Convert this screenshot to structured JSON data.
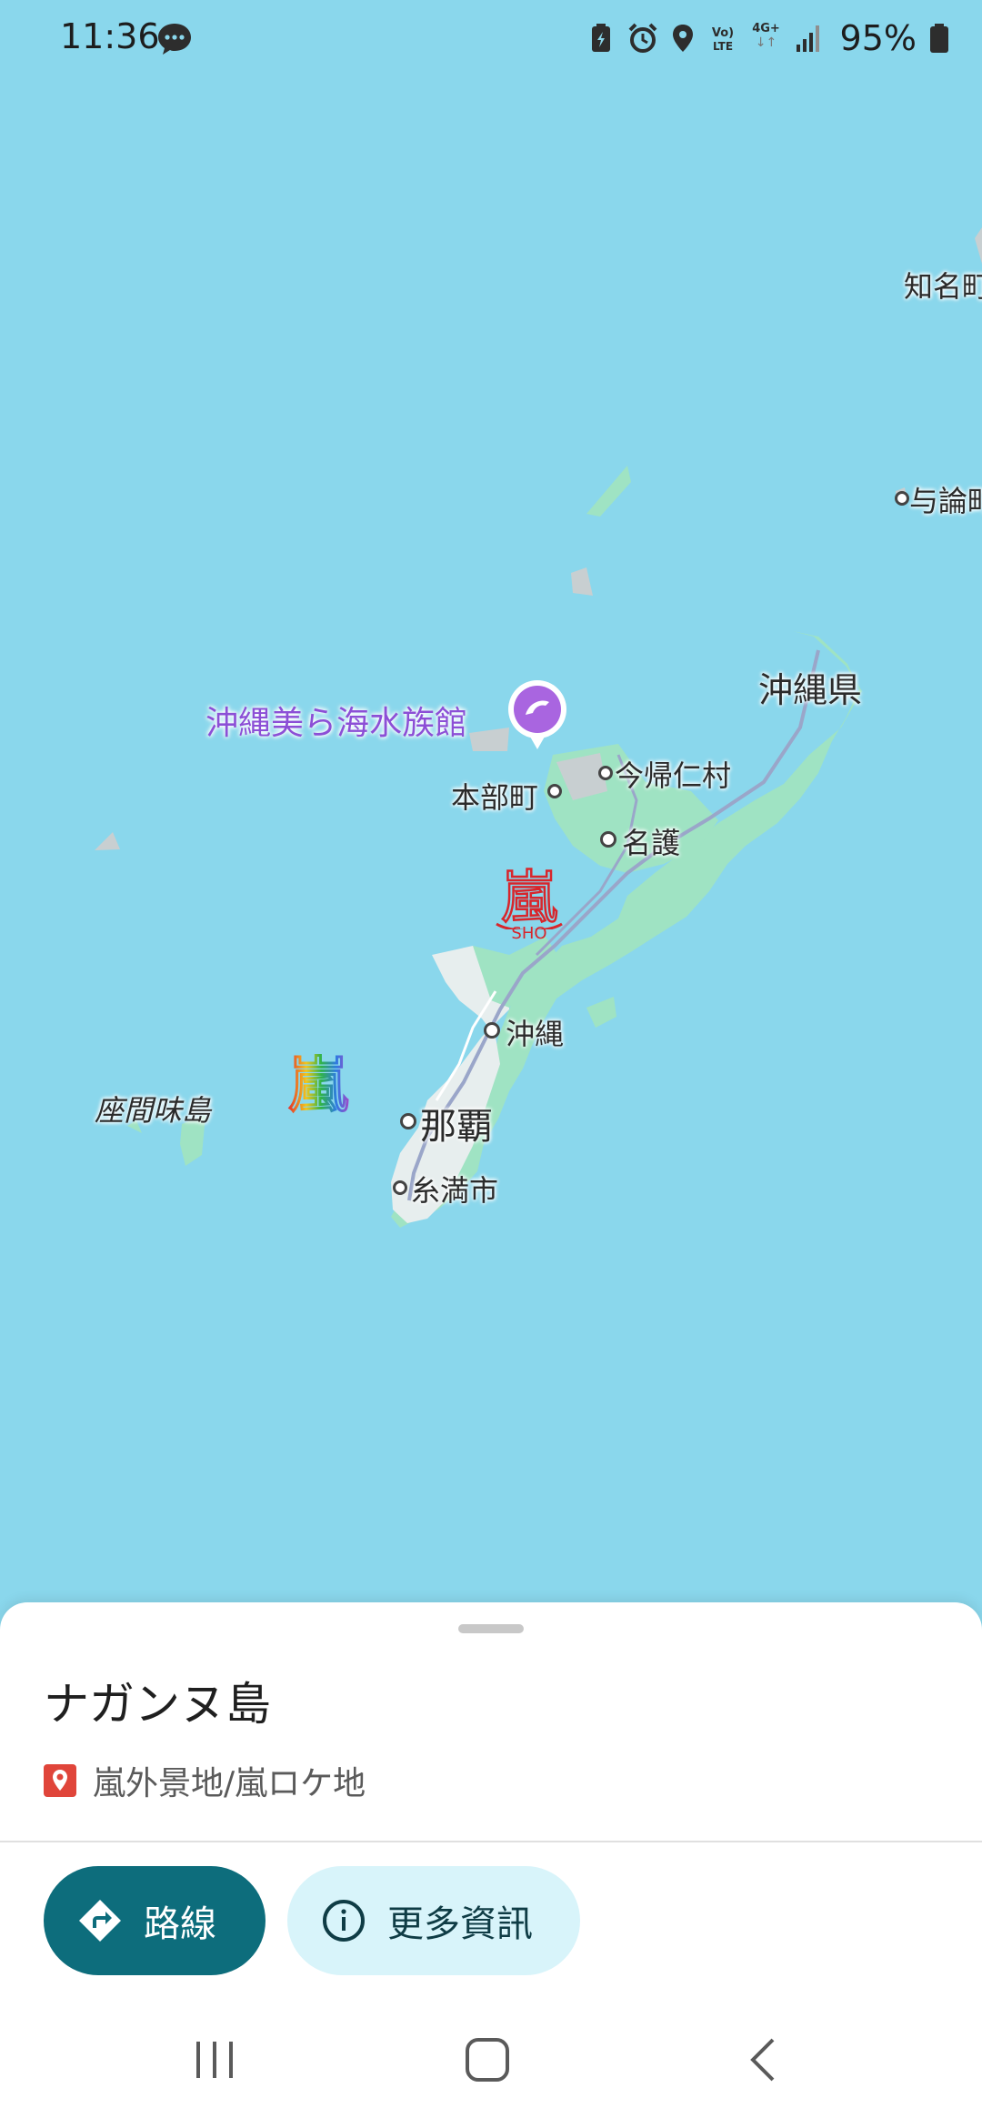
{
  "status_bar": {
    "time": "11:36",
    "network_label": "4G+",
    "battery_percent": "95%",
    "icons": [
      "chat-bubble-icon",
      "battery-saver-icon",
      "alarm-icon",
      "location-icon",
      "volte-icon",
      "network-4g-icon",
      "signal-icon",
      "battery-icon"
    ]
  },
  "map": {
    "places": {
      "chinen": "知名町",
      "yoron": "与論町",
      "okinawa_pref": "沖縄県",
      "churaumi": "沖縄美ら海水族館",
      "motobu": "本部町",
      "nakijin": "今帰仁村",
      "nago": "名護",
      "okinawa_city": "沖縄",
      "naha": "那覇",
      "itoman": "糸満市",
      "zamami": "座間味島"
    },
    "marker_sho_label": "SHO",
    "marker_glyph": "嵐",
    "colors": {
      "sea": "#8ad7ec",
      "land": "#9fe3c3",
      "urban": "#e7eeee",
      "poi": "#a965e0"
    }
  },
  "sheet": {
    "title": "ナガンヌ島",
    "subtitle": "嵐外景地/嵐ロケ地",
    "route_label": "路線",
    "info_label": "更多資訊"
  },
  "nav": {
    "items": [
      "recent-apps",
      "home",
      "back"
    ]
  }
}
